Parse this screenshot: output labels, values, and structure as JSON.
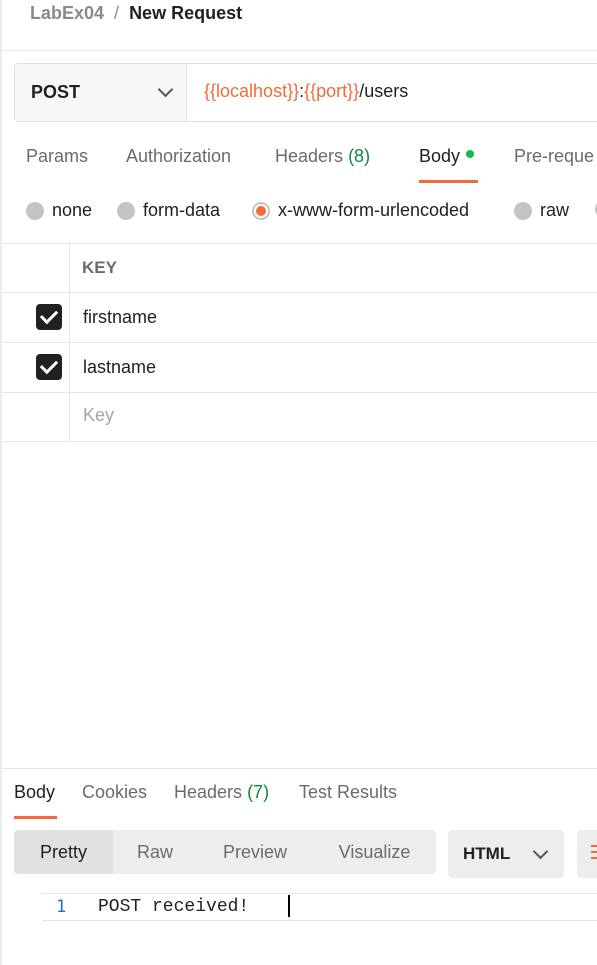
{
  "breadcrumb": {
    "parent": "LabEx04",
    "separator": "/",
    "current": "New Request"
  },
  "request": {
    "method": "POST",
    "url_parts": [
      {
        "text": "{{localhost}}",
        "kind": "variable"
      },
      {
        "text": ":",
        "kind": "plain"
      },
      {
        "text": "{{port}}",
        "kind": "variable"
      },
      {
        "text": "/users",
        "kind": "plain"
      }
    ]
  },
  "request_tabs": {
    "params": "Params",
    "authorization": "Authorization",
    "headers": "Headers",
    "headers_count": "(8)",
    "body": "Body",
    "pre_request": "Pre-reque",
    "active": "Body"
  },
  "body_types": {
    "none": "none",
    "form_data": "form-data",
    "urlencoded": "x-www-form-urlencoded",
    "raw": "raw",
    "selected": "x-www-form-urlencoded"
  },
  "kv_table": {
    "key_header": "KEY",
    "rows": [
      {
        "key": "firstname",
        "checked": true
      },
      {
        "key": "lastname",
        "checked": true
      }
    ],
    "placeholder": "Key"
  },
  "response": {
    "tabs": {
      "body": "Body",
      "cookies": "Cookies",
      "headers": "Headers",
      "headers_count": "(7)",
      "test_results": "Test Results",
      "active": "Body"
    },
    "views": {
      "pretty": "Pretty",
      "raw": "Raw",
      "preview": "Preview",
      "visualize": "Visualize",
      "active": "Pretty"
    },
    "format": "HTML",
    "code": {
      "line_number": "1",
      "text": "POST received!"
    }
  },
  "colors": {
    "accent": "#f26b3a",
    "success": "#0cbb52",
    "count_text": "#0c8a3a",
    "line_number": "#1e6fbf"
  },
  "icons": [
    "chevron-down-icon",
    "checkbox-checked-icon",
    "wrap-lines-icon",
    "status-dot-icon"
  ]
}
